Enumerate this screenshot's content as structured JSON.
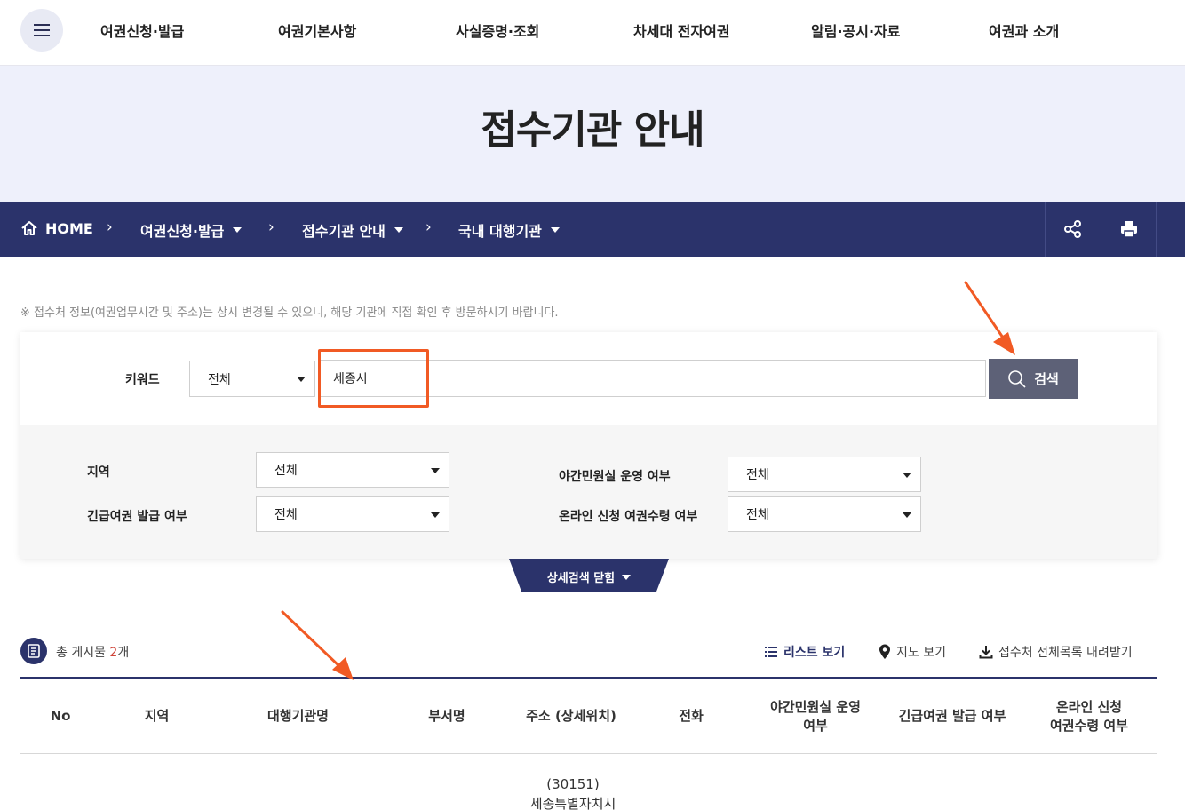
{
  "nav": {
    "items": [
      "여권신청·발급",
      "여권기본사항",
      "사실증명·조회",
      "차세대 전자여권",
      "알림·공시·자료",
      "여권과 소개"
    ]
  },
  "hero": {
    "title": "접수기관 안내"
  },
  "breadcrumb": {
    "home": "HOME",
    "items": [
      "여권신청·발급",
      "접수기관 안내",
      "국내 대행기관"
    ]
  },
  "notice": "※ 접수처 정보(여권업무시간 및 주소)는 상시 변경될 수 있으니, 해당 기관에 직접 확인 후 방문하시기 바랍니다.",
  "search": {
    "keyword_label": "키워드",
    "scope_value": "전체",
    "keyword_value": "세종시",
    "button_label": "검색",
    "filters": {
      "region_label": "지역",
      "region_value": "전체",
      "emergency_label": "긴급여권 발급 여부",
      "emergency_value": "전체",
      "night_label": "야간민원실 운영 여부",
      "night_value": "전체",
      "online_label": "온라인 신청 여권수령 여부",
      "online_value": "전체"
    },
    "collapse_label": "상세검색 닫힘"
  },
  "results": {
    "total_prefix": "총 게시물 ",
    "total_count": "2",
    "total_suffix": "개",
    "view_list": "리스트 보기",
    "view_map": "지도 보기",
    "download": "접수처 전체목록 내려받기"
  },
  "table": {
    "headers": [
      "No",
      "지역",
      "대행기관명",
      "부서명",
      "주소 (상세위치)",
      "전화",
      "야간민원실 운영\n여부",
      "긴급여권 발급 여부",
      "온라인 신청\n여권수령 여부"
    ],
    "rows": [
      {
        "address_line1": "(30151)",
        "address_line2": "세종특별자치시"
      }
    ]
  },
  "colors": {
    "navy": "#2b336b",
    "hero_bg": "#eef0fb",
    "search_button": "#5d6177",
    "highlight": "#f15a24",
    "count_red": "#d0463b"
  },
  "icons": [
    "menu-icon",
    "home-icon",
    "share-icon",
    "print-icon",
    "search-icon",
    "document-icon",
    "list-icon",
    "map-pin-icon",
    "download-icon"
  ]
}
